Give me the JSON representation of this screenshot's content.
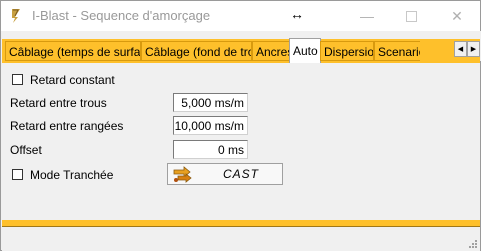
{
  "window": {
    "title": "I-Blast - Sequence d'amorçage",
    "minimize_glyph": "—",
    "close_glyph": "✕",
    "resize_glyph": "↔"
  },
  "tabs": [
    {
      "label": "Câblage (temps de surface)",
      "active": false
    },
    {
      "label": "Câblage (fond de trou)",
      "active": false
    },
    {
      "label": "Ancres",
      "active": false
    },
    {
      "label": "Auto",
      "active": true
    },
    {
      "label": "Dispersion",
      "active": false
    },
    {
      "label": "Scenario",
      "active": false
    }
  ],
  "tab_scroll": {
    "left_glyph": "◀",
    "right_glyph": "▶"
  },
  "form": {
    "retard_constant": {
      "label": "Retard constant",
      "checked": false
    },
    "retard_trous": {
      "label": "Retard entre trous",
      "value": "5,000 ms/m"
    },
    "retard_rangees": {
      "label": "Retard entre rangées",
      "value": "10,000 ms/m"
    },
    "offset": {
      "label": "Offset",
      "value": "0 ms"
    },
    "mode_tranchee": {
      "label": "Mode Tranchée",
      "checked": false
    },
    "cast_button": {
      "label": "CAST",
      "icon": "cast-arrows-icon"
    }
  },
  "colors": {
    "accent": "#fec02b",
    "accent_border": "#d89a0e"
  }
}
